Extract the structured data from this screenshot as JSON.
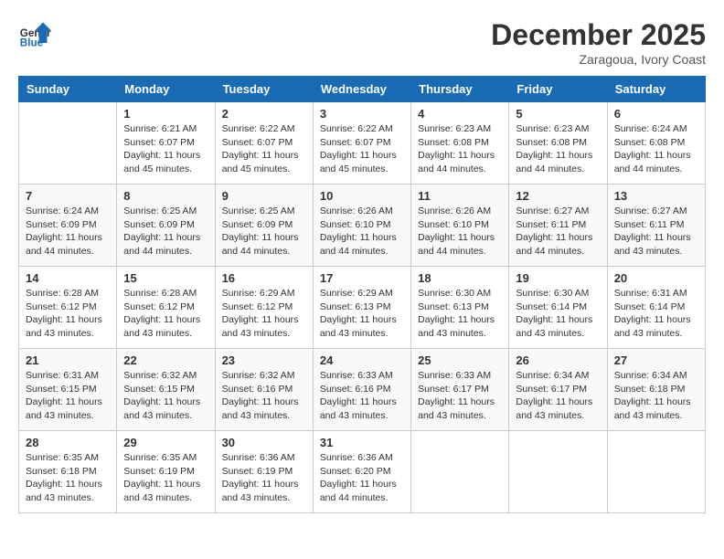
{
  "header": {
    "logo_general": "General",
    "logo_blue": "Blue",
    "month_title": "December 2025",
    "location": "Zaragoua, Ivory Coast"
  },
  "weekdays": [
    "Sunday",
    "Monday",
    "Tuesday",
    "Wednesday",
    "Thursday",
    "Friday",
    "Saturday"
  ],
  "weeks": [
    [
      {
        "day": "",
        "info": ""
      },
      {
        "day": "1",
        "info": "Sunrise: 6:21 AM\nSunset: 6:07 PM\nDaylight: 11 hours and 45 minutes."
      },
      {
        "day": "2",
        "info": "Sunrise: 6:22 AM\nSunset: 6:07 PM\nDaylight: 11 hours and 45 minutes."
      },
      {
        "day": "3",
        "info": "Sunrise: 6:22 AM\nSunset: 6:07 PM\nDaylight: 11 hours and 45 minutes."
      },
      {
        "day": "4",
        "info": "Sunrise: 6:23 AM\nSunset: 6:08 PM\nDaylight: 11 hours and 44 minutes."
      },
      {
        "day": "5",
        "info": "Sunrise: 6:23 AM\nSunset: 6:08 PM\nDaylight: 11 hours and 44 minutes."
      },
      {
        "day": "6",
        "info": "Sunrise: 6:24 AM\nSunset: 6:08 PM\nDaylight: 11 hours and 44 minutes."
      }
    ],
    [
      {
        "day": "7",
        "info": "Sunrise: 6:24 AM\nSunset: 6:09 PM\nDaylight: 11 hours and 44 minutes."
      },
      {
        "day": "8",
        "info": "Sunrise: 6:25 AM\nSunset: 6:09 PM\nDaylight: 11 hours and 44 minutes."
      },
      {
        "day": "9",
        "info": "Sunrise: 6:25 AM\nSunset: 6:09 PM\nDaylight: 11 hours and 44 minutes."
      },
      {
        "day": "10",
        "info": "Sunrise: 6:26 AM\nSunset: 6:10 PM\nDaylight: 11 hours and 44 minutes."
      },
      {
        "day": "11",
        "info": "Sunrise: 6:26 AM\nSunset: 6:10 PM\nDaylight: 11 hours and 44 minutes."
      },
      {
        "day": "12",
        "info": "Sunrise: 6:27 AM\nSunset: 6:11 PM\nDaylight: 11 hours and 44 minutes."
      },
      {
        "day": "13",
        "info": "Sunrise: 6:27 AM\nSunset: 6:11 PM\nDaylight: 11 hours and 43 minutes."
      }
    ],
    [
      {
        "day": "14",
        "info": "Sunrise: 6:28 AM\nSunset: 6:12 PM\nDaylight: 11 hours and 43 minutes."
      },
      {
        "day": "15",
        "info": "Sunrise: 6:28 AM\nSunset: 6:12 PM\nDaylight: 11 hours and 43 minutes."
      },
      {
        "day": "16",
        "info": "Sunrise: 6:29 AM\nSunset: 6:12 PM\nDaylight: 11 hours and 43 minutes."
      },
      {
        "day": "17",
        "info": "Sunrise: 6:29 AM\nSunset: 6:13 PM\nDaylight: 11 hours and 43 minutes."
      },
      {
        "day": "18",
        "info": "Sunrise: 6:30 AM\nSunset: 6:13 PM\nDaylight: 11 hours and 43 minutes."
      },
      {
        "day": "19",
        "info": "Sunrise: 6:30 AM\nSunset: 6:14 PM\nDaylight: 11 hours and 43 minutes."
      },
      {
        "day": "20",
        "info": "Sunrise: 6:31 AM\nSunset: 6:14 PM\nDaylight: 11 hours and 43 minutes."
      }
    ],
    [
      {
        "day": "21",
        "info": "Sunrise: 6:31 AM\nSunset: 6:15 PM\nDaylight: 11 hours and 43 minutes."
      },
      {
        "day": "22",
        "info": "Sunrise: 6:32 AM\nSunset: 6:15 PM\nDaylight: 11 hours and 43 minutes."
      },
      {
        "day": "23",
        "info": "Sunrise: 6:32 AM\nSunset: 6:16 PM\nDaylight: 11 hours and 43 minutes."
      },
      {
        "day": "24",
        "info": "Sunrise: 6:33 AM\nSunset: 6:16 PM\nDaylight: 11 hours and 43 minutes."
      },
      {
        "day": "25",
        "info": "Sunrise: 6:33 AM\nSunset: 6:17 PM\nDaylight: 11 hours and 43 minutes."
      },
      {
        "day": "26",
        "info": "Sunrise: 6:34 AM\nSunset: 6:17 PM\nDaylight: 11 hours and 43 minutes."
      },
      {
        "day": "27",
        "info": "Sunrise: 6:34 AM\nSunset: 6:18 PM\nDaylight: 11 hours and 43 minutes."
      }
    ],
    [
      {
        "day": "28",
        "info": "Sunrise: 6:35 AM\nSunset: 6:18 PM\nDaylight: 11 hours and 43 minutes."
      },
      {
        "day": "29",
        "info": "Sunrise: 6:35 AM\nSunset: 6:19 PM\nDaylight: 11 hours and 43 minutes."
      },
      {
        "day": "30",
        "info": "Sunrise: 6:36 AM\nSunset: 6:19 PM\nDaylight: 11 hours and 43 minutes."
      },
      {
        "day": "31",
        "info": "Sunrise: 6:36 AM\nSunset: 6:20 PM\nDaylight: 11 hours and 44 minutes."
      },
      {
        "day": "",
        "info": ""
      },
      {
        "day": "",
        "info": ""
      },
      {
        "day": "",
        "info": ""
      }
    ]
  ]
}
